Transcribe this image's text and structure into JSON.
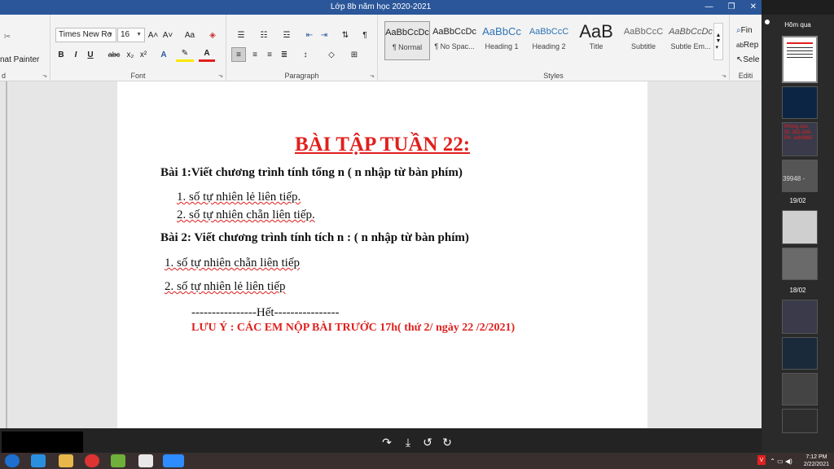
{
  "window": {
    "title": "Lớp 8b năm học 2020-2021"
  },
  "ribbon": {
    "clipboard": {
      "format_painter": "nat Painter"
    },
    "font": {
      "label": "Font",
      "family": "Times New Ro",
      "size": "16",
      "bold": "B",
      "italic": "I",
      "underline": "U",
      "strike": "abc",
      "sub": "x₂",
      "sup": "x²",
      "grow": "A˄",
      "shrink": "A˅",
      "case": "Aa"
    },
    "paragraph": {
      "label": "Paragraph"
    },
    "styles": {
      "label": "Styles",
      "items": [
        {
          "preview": "AaBbCcDc",
          "name": "¶ Normal"
        },
        {
          "preview": "AaBbCcDc",
          "name": "¶ No Spac..."
        },
        {
          "preview": "AaBbCc",
          "name": "Heading 1"
        },
        {
          "preview": "AaBbCcC",
          "name": "Heading 2"
        },
        {
          "preview": "AaB",
          "name": "Title"
        },
        {
          "preview": "AaBbCcC",
          "name": "Subtitle"
        },
        {
          "preview": "AaBbCcDc",
          "name": "Subtle Em..."
        }
      ]
    },
    "editing": {
      "label": "Editi",
      "find": "Fin",
      "replace": "Rep",
      "select": "Sele"
    }
  },
  "document": {
    "title": "BÀI TẬP TUẦN 22:",
    "bai1": "Bài 1:Viết chương trình tính tổng n  ( n nhập từ bàn phím)",
    "bai1_items": [
      "1.  số tự nhiên lẻ liên tiếp.",
      "2.   số tự nhiên chẵn liên tiếp."
    ],
    "bai2": "Bài 2: Viết chương trình tính tích n : ( n nhập từ bàn phím)",
    "bai2_items": [
      "1. số tự nhiên chẵn liên tiếp",
      "2. số tự nhiên lẻ liên tiếp"
    ],
    "end": "----------------Hết----------------",
    "note": "LƯU Ý : CÁC EM NỘP BÀI TRƯỚC 17h( thứ 2/ ngày 22 /2/2021)"
  },
  "sidepanel": {
    "labels": [
      "Hôm qua",
      "19/02",
      "18/02"
    ],
    "phong_zoom": "Phòng zoo",
    "id_text": "ID: 382-206-",
    "pk_text": "PK: anh8885",
    "code": "39948 -"
  },
  "taskbar": {
    "time": "7:12 PM",
    "date": "2/22/2021"
  },
  "colors": {
    "title_red": "#e0201e",
    "word_blue": "#2b579a"
  }
}
